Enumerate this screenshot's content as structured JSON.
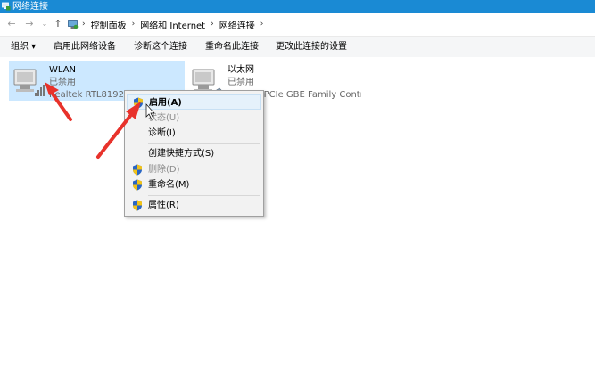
{
  "window": {
    "title": "网络连接"
  },
  "address": {
    "crumbs": [
      "控制面板",
      "网络和 Internet",
      "网络连接"
    ],
    "sep": "›"
  },
  "toolbar": {
    "organize": "组织 ▾",
    "enable_device": "启用此网络设备",
    "diagnose": "诊断这个连接",
    "rename": "重命名此连接",
    "change_settings": "更改此连接的设置"
  },
  "adapters": [
    {
      "name": "WLAN",
      "status": "已禁用",
      "device": "Realtek RTL8192EU Wireless L...",
      "selected": true,
      "icon": "wireless-adapter-icon"
    },
    {
      "name": "以太网",
      "status": "已禁用",
      "device": "Realtek PCIe GBE Family Contr...",
      "selected": false,
      "icon": "ethernet-adapter-icon"
    }
  ],
  "context_menu": {
    "items": [
      {
        "label": "启用(A)",
        "shield": true,
        "bold": true,
        "highlighted": true,
        "disabled": false
      },
      {
        "label": "状态(U)",
        "shield": false,
        "bold": false,
        "highlighted": false,
        "disabled": true
      },
      {
        "label": "诊断(I)",
        "shield": false,
        "bold": false,
        "highlighted": false,
        "disabled": false
      },
      {
        "label": "创建快捷方式(S)",
        "shield": false,
        "bold": false,
        "highlighted": false,
        "disabled": false
      },
      {
        "label": "删除(D)",
        "shield": true,
        "bold": false,
        "highlighted": false,
        "disabled": true
      },
      {
        "label": "重命名(M)",
        "shield": true,
        "bold": false,
        "highlighted": false,
        "disabled": false
      },
      {
        "label": "属性(R)",
        "shield": true,
        "bold": false,
        "highlighted": false,
        "disabled": false
      }
    ]
  },
  "colors": {
    "titlebar": "#1a8ad4",
    "selection": "#cce8ff",
    "annotation_arrow": "#e8322b"
  }
}
